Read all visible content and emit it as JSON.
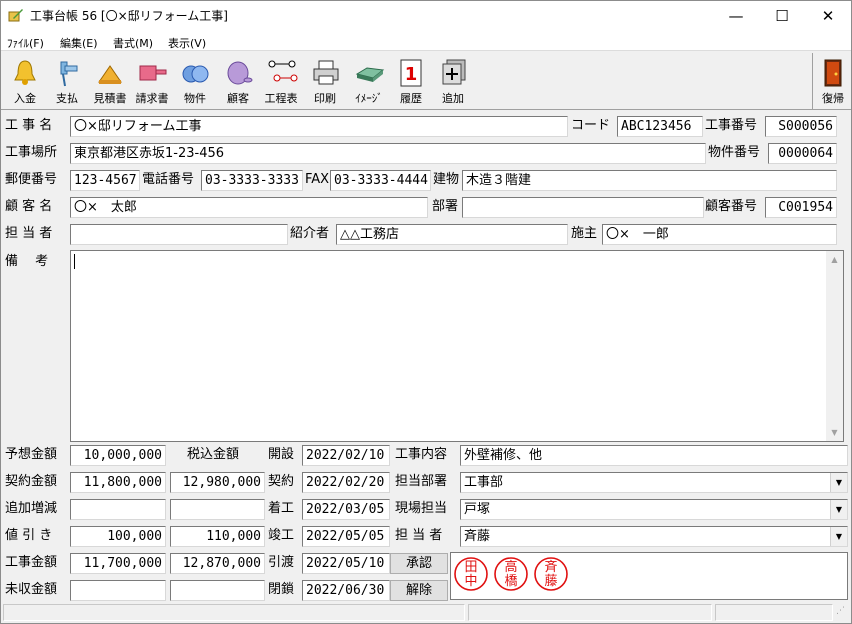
{
  "window": {
    "title": "工事台帳 56 [〇×邸リフォーム工事]",
    "minimize": "—",
    "maximize": "☐",
    "close": "✕"
  },
  "menu": [
    "ﾌｧｲﾙ(F)",
    "編集(E)",
    "書式(M)",
    "表示(V)"
  ],
  "toolbar": {
    "items": [
      "入金",
      "支払",
      "見積書",
      "請求書",
      "物件",
      "顧客",
      "工程表",
      "印刷",
      "ｲﾒｰｼﾞ",
      "履歴",
      "追加"
    ],
    "restore": "復帰",
    "calendar_day": "1"
  },
  "form": {
    "project_name_label": "工 事 名",
    "project_name": "〇×邸リフォーム工事",
    "code_label": "コード",
    "code": "ABC123456",
    "project_no_label": "工事番号",
    "project_no": "S000056",
    "site_label": "工事場所",
    "site": "東京都港区赤坂1-23-456",
    "property_no_label": "物件番号",
    "property_no": "0000064",
    "zip_label": "郵便番号",
    "zip": "123-4567",
    "phone_label": "電話番号",
    "phone": "03-3333-3333",
    "fax_label": "FAX",
    "fax": "03-3333-4444",
    "building_label": "建物",
    "building": "木造３階建",
    "customer_label": "顧 客 名",
    "customer": "〇×　太郎",
    "dept_label": "部署",
    "dept": "",
    "customer_no_label": "顧客番号",
    "customer_no": "C001954",
    "staff_label": "担 当 者",
    "staff": "",
    "introducer_label": "紹介者",
    "introducer": "△△工務店",
    "owner_label": "施主",
    "owner": "〇×　一郎",
    "memo_label": "備　 考",
    "memo": ""
  },
  "amounts": {
    "estimate_label": "予想金額",
    "estimate": "10,000,000",
    "tax_in_label": "税込金額",
    "contract_label": "契約金額",
    "contract": "11,800,000",
    "contract_tax": "12,980,000",
    "adjust_label": "追加増減",
    "adjust": "",
    "adjust_tax": "",
    "discount_label": "値 引 き",
    "discount": "100,000",
    "discount_tax": "110,000",
    "total_label": "工事金額",
    "total": "11,700,000",
    "total_tax": "12,870,000",
    "unpaid_label": "未収金額",
    "unpaid": "",
    "unpaid_tax": ""
  },
  "dates": {
    "open_label": "開設",
    "open": "2022/02/10",
    "contract_label": "契約",
    "contract": "2022/02/20",
    "start_label": "着工",
    "start": "2022/03/05",
    "complete_label": "竣工",
    "complete": "2022/05/05",
    "handover_label": "引渡",
    "handover": "2022/05/10",
    "close_label": "閉鎖",
    "close": "2022/06/30"
  },
  "details": {
    "work_label": "工事内容",
    "work": "外壁補修、他",
    "dept_label": "担当部署",
    "dept": "工事部",
    "site_staff_label": "現場担当",
    "site_staff": "戸塚",
    "staff_label": "担 当 者",
    "staff": "斉藤"
  },
  "approval": {
    "approve_button": "承認",
    "cancel_button": "解除",
    "stamps": [
      {
        "chars": [
          "田",
          "中"
        ]
      },
      {
        "chars": [
          "高",
          "橋"
        ]
      },
      {
        "chars": [
          "斉",
          "藤"
        ]
      }
    ]
  },
  "colors": {
    "stamp": "#e01010",
    "window_bg": "#f0f0f0",
    "field_bg": "#ffffff"
  }
}
